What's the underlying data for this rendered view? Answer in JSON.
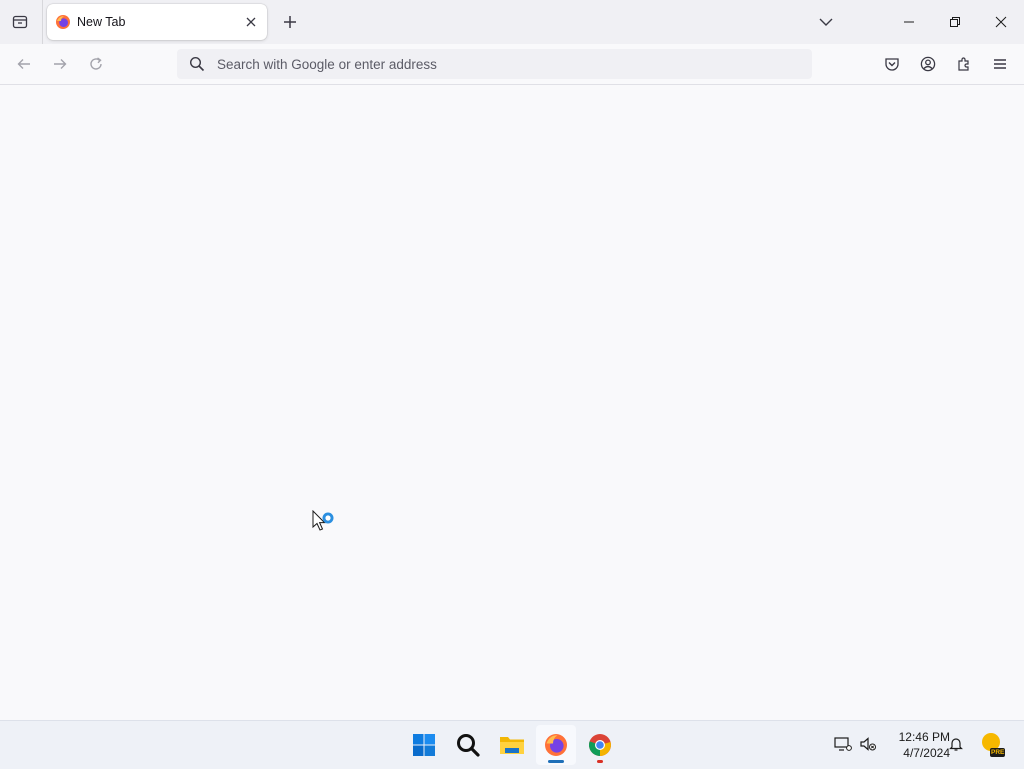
{
  "browser": {
    "tab": {
      "title": "New Tab",
      "favicon": "firefox-icon"
    },
    "new_tab_icon": "plus-icon",
    "list_all_tabs_icon": "chevron-down-icon",
    "window_controls": [
      "minimize-icon",
      "restore-icon",
      "close-icon"
    ]
  },
  "navbar": {
    "back_icon": "arrow-left-icon",
    "forward_icon": "arrow-right-icon",
    "reload_icon": "reload-icon",
    "address": {
      "placeholder": "Search with Google or enter address",
      "value": ""
    },
    "toolbar_icons": [
      "pocket-icon",
      "account-icon",
      "extensions-icon",
      "hamburger-menu-icon"
    ]
  },
  "taskbar": {
    "apps": [
      {
        "name": "Start",
        "icon": "windows-start-icon"
      },
      {
        "name": "Search",
        "icon": "search-icon"
      },
      {
        "name": "File Explorer",
        "icon": "folder-icon"
      },
      {
        "name": "Firefox",
        "icon": "firefox-icon",
        "active": true,
        "indicator_color": "#1e6fb8"
      },
      {
        "name": "Chrome",
        "icon": "chrome-icon",
        "running": true,
        "indicator_color": "#d93025"
      }
    ],
    "tray": {
      "time": "12:46 PM",
      "date": "4/7/2024",
      "weather_badge": "PRE"
    }
  },
  "colors": {
    "accent": "#0060df",
    "tab_strip": "#f0f0f4",
    "content_bg": "#f9f9fb"
  }
}
